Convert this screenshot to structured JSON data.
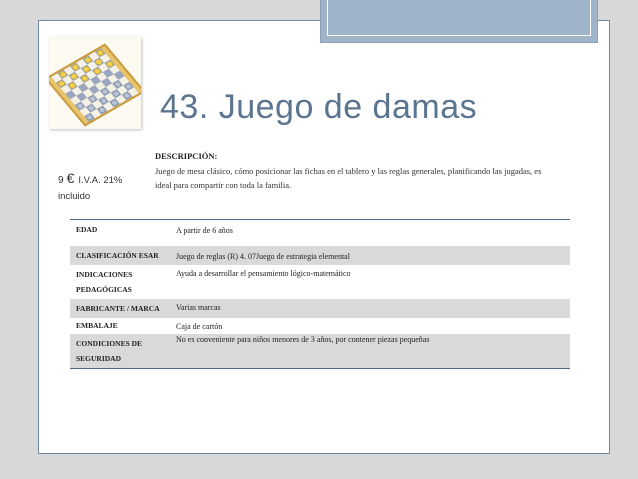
{
  "title": "43. Juego de damas",
  "price": {
    "amount": "9",
    "currency_symbol": "€",
    "tax_note": "I.V.A. 21%",
    "tax_note_suffix": "incluido"
  },
  "description": {
    "heading": "DESCRIPCIÓN:",
    "text": "Juego de mesa clásico, cómo posicionar las fichas en el tablero y las reglas generales, planificando las jugadas, es ideal para compartir con toda la familia."
  },
  "specs": [
    {
      "key": "EDAD",
      "value": "A partir de 6 años"
    },
    {
      "key": "CLASIFICACIÓN ESAR",
      "value": "Juego de reglas (R) 4. 07Juego de estrategia elemental"
    },
    {
      "key": "INDICACIONES PEDAGÓGICAS",
      "value": "Ayuda a desarrollar el pensamiento lógico-matemático"
    },
    {
      "key": "FABRICANTE / MARCA",
      "value": "Varias marcas"
    },
    {
      "key": "EMBALAJE",
      "value": "Caja de cartón"
    },
    {
      "key": "CONDICIONES DE SEGURIDAD",
      "value": "No es conveniente para niños menores de 3 años, por contener piezas pequeñas"
    }
  ],
  "colors": {
    "title": "#5b7590",
    "accent_bar": "#9fb3c9",
    "table_rule": "#4a6a8c",
    "row_shade": "#d9d9d9"
  },
  "icons": [
    "checkers-board-image"
  ]
}
